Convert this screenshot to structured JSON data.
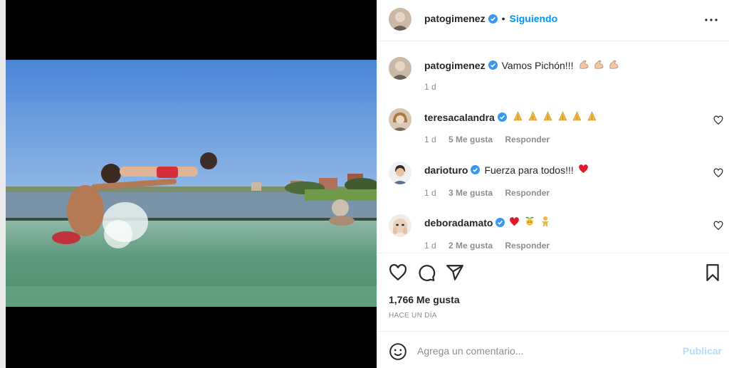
{
  "post": {
    "author": "patogimenez",
    "follow_status": "Siguiendo",
    "separator": "•",
    "caption": {
      "username": "patogimenez",
      "text": "Vamos Pichón!!!",
      "emoji": [
        "flexed-biceps",
        "flexed-biceps",
        "flexed-biceps"
      ],
      "time": "1 d"
    },
    "comments": [
      {
        "username": "teresacalandra",
        "text": "",
        "emoji": [
          "folded-hands",
          "folded-hands",
          "folded-hands",
          "folded-hands",
          "folded-hands",
          "folded-hands"
        ],
        "time": "1 d",
        "likes": "5 Me gusta",
        "reply": "Responder"
      },
      {
        "username": "darioturo",
        "text": "Fuerza para todos!!!",
        "emoji": [
          "red-heart"
        ],
        "time": "1 d",
        "likes": "3 Me gusta",
        "reply": "Responder"
      },
      {
        "username": "deboradamato",
        "text": "",
        "emoji": [
          "red-heart",
          "sprout-face",
          "yellow-figure"
        ],
        "time": "1 d",
        "likes": "2 Me gusta",
        "reply": "Responder"
      }
    ],
    "like_count": "1,766 Me gusta",
    "timestamp": "HACE UN DÍA",
    "composer": {
      "placeholder": "Agrega un comentario...",
      "submit": "Publicar"
    }
  },
  "colors": {
    "accent": "#0095f6",
    "accent_disabled": "#b3dbff",
    "text": "#262626",
    "secondary_text": "#8e8e8e",
    "divider": "#efefef",
    "like_red": "#ed4956"
  },
  "icons": {
    "verified": "verified-badge-icon",
    "more": "more-options-icon",
    "like": "heart-icon",
    "comment": "comment-icon",
    "share": "paper-plane-icon",
    "save": "bookmark-icon",
    "emoji_picker": "smiley-icon"
  }
}
